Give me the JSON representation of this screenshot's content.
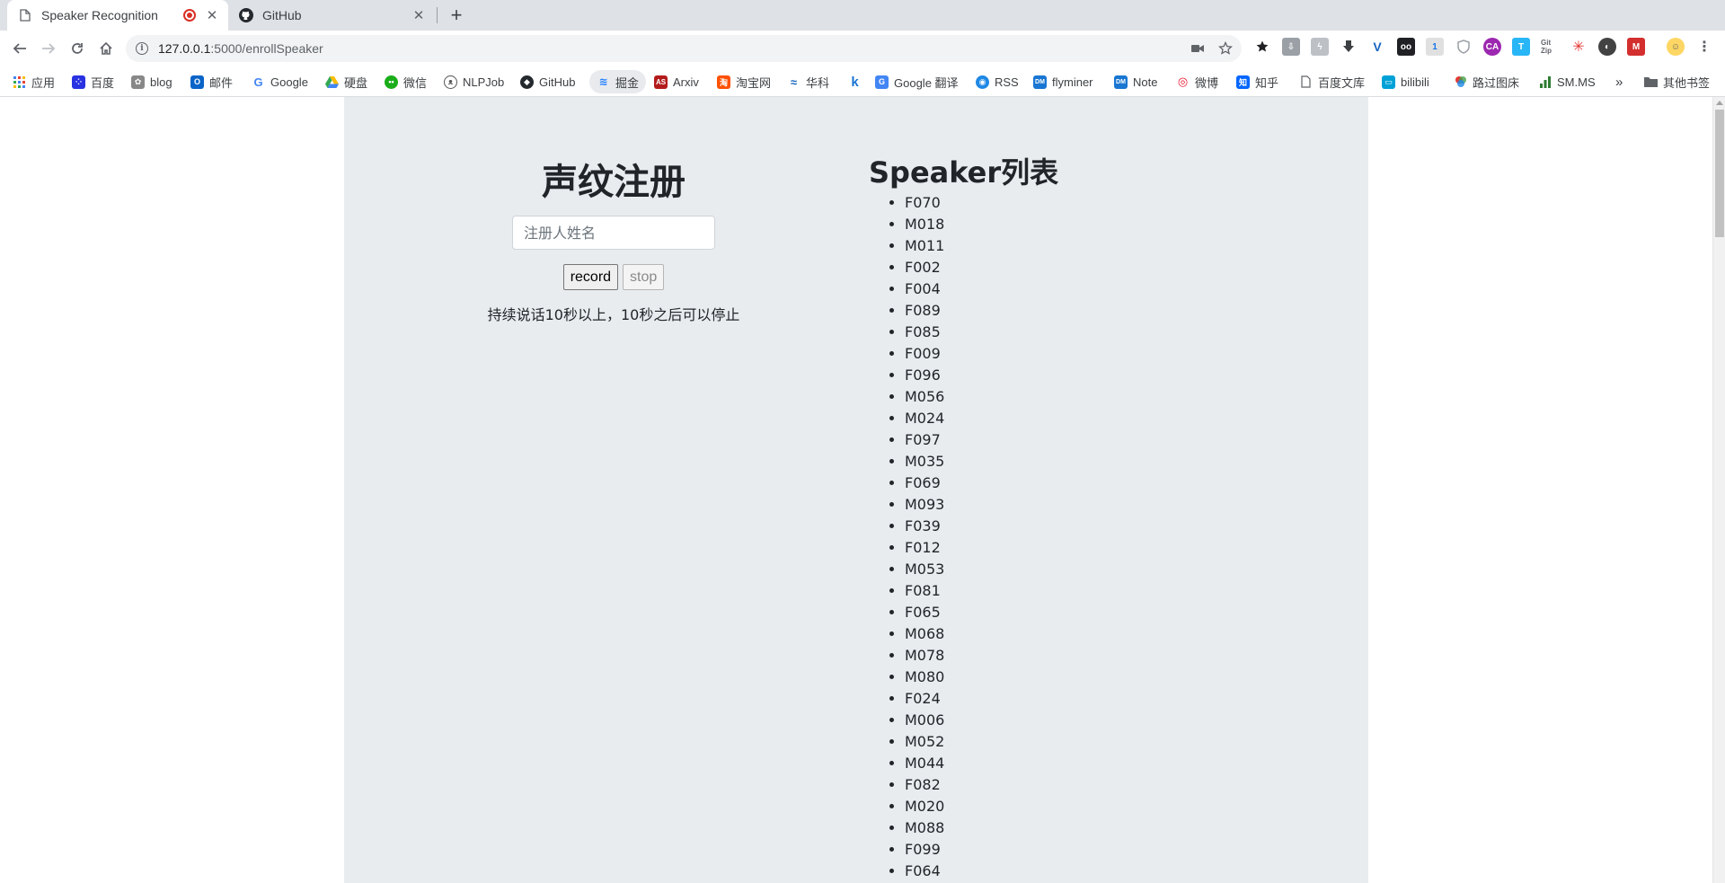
{
  "tabs": [
    {
      "title": "Speaker Recognition",
      "active": true,
      "recording": true
    },
    {
      "title": "GitHub",
      "active": false
    }
  ],
  "toolbar": {
    "url_host": "127.0.0.1",
    "url_rest": ":5000/enrollSpeaker"
  },
  "bookmarks": [
    {
      "label": "应用",
      "icon": "apps-grid-icon",
      "color": "#4285f4"
    },
    {
      "label": "百度",
      "icon": "baidu-icon",
      "color": "#2932e1"
    },
    {
      "label": "blog",
      "icon": "blog-icon",
      "color": "#888888"
    },
    {
      "label": "邮件",
      "icon": "outlook-icon",
      "color": "#0a64c8"
    },
    {
      "label": "Google",
      "icon": "google-icon",
      "color": "#4285f4"
    },
    {
      "label": "硬盘",
      "icon": "drive-icon",
      "color": "#fbbc04"
    },
    {
      "label": "微信",
      "icon": "wechat-icon",
      "color": "#1aad19"
    },
    {
      "label": "NLPJob",
      "icon": "nlpjob-icon",
      "color": "#555555"
    },
    {
      "label": "GitHub",
      "icon": "github-icon",
      "color": "#24292e"
    },
    {
      "label": "掘金",
      "icon": "juejin-icon",
      "color": "#1e80ff"
    },
    {
      "label": "Arxiv",
      "icon": "arxiv-icon",
      "color": "#b31b1b"
    },
    {
      "label": "淘宝网",
      "icon": "taobao-icon",
      "color": "#ff5000"
    },
    {
      "label": "华科",
      "icon": "hust-icon",
      "color": "#1565c0"
    },
    {
      "label": "",
      "icon": "k-icon",
      "color": "#1976d2"
    },
    {
      "label": "Google 翻译",
      "icon": "translate-icon",
      "color": "#4285f4"
    },
    {
      "label": "RSS",
      "icon": "rss-icon",
      "color": "#1e88e5"
    },
    {
      "label": "flyminer",
      "icon": "flyminer-icon",
      "color": "#1976d2"
    },
    {
      "label": "Note",
      "icon": "note-icon",
      "color": "#1976d2"
    },
    {
      "label": "微博",
      "icon": "weibo-icon",
      "color": "#e6162d"
    },
    {
      "label": "知乎",
      "icon": "zhihu-icon",
      "color": "#0066ff"
    },
    {
      "label": "百度文库",
      "icon": "document-icon",
      "color": "#5f6368"
    },
    {
      "label": "bilibili",
      "icon": "bilibili-icon",
      "color": "#00a1d6"
    },
    {
      "label": "路过图床",
      "icon": "image-host-icon",
      "color": "#e53935"
    },
    {
      "label": "SM.MS",
      "icon": "smms-icon",
      "color": "#2e7d32"
    }
  ],
  "bookmarks_more": "»",
  "other_bookmarks": "其他书签",
  "enroll": {
    "title": "声纹注册",
    "name_placeholder": "注册人姓名",
    "record_label": "record",
    "stop_label": "stop",
    "hint": "持续说话10秒以上，10秒之后可以停止"
  },
  "speakers": {
    "title": "Speaker列表",
    "items": [
      "F070",
      "M018",
      "M011",
      "F002",
      "F004",
      "F089",
      "F085",
      "F009",
      "F096",
      "M056",
      "M024",
      "F097",
      "M035",
      "F069",
      "M093",
      "F039",
      "F012",
      "M053",
      "F081",
      "F065",
      "M068",
      "M078",
      "M080",
      "F024",
      "M006",
      "M052",
      "M044",
      "F082",
      "M020",
      "M088",
      "F099",
      "F064"
    ]
  }
}
